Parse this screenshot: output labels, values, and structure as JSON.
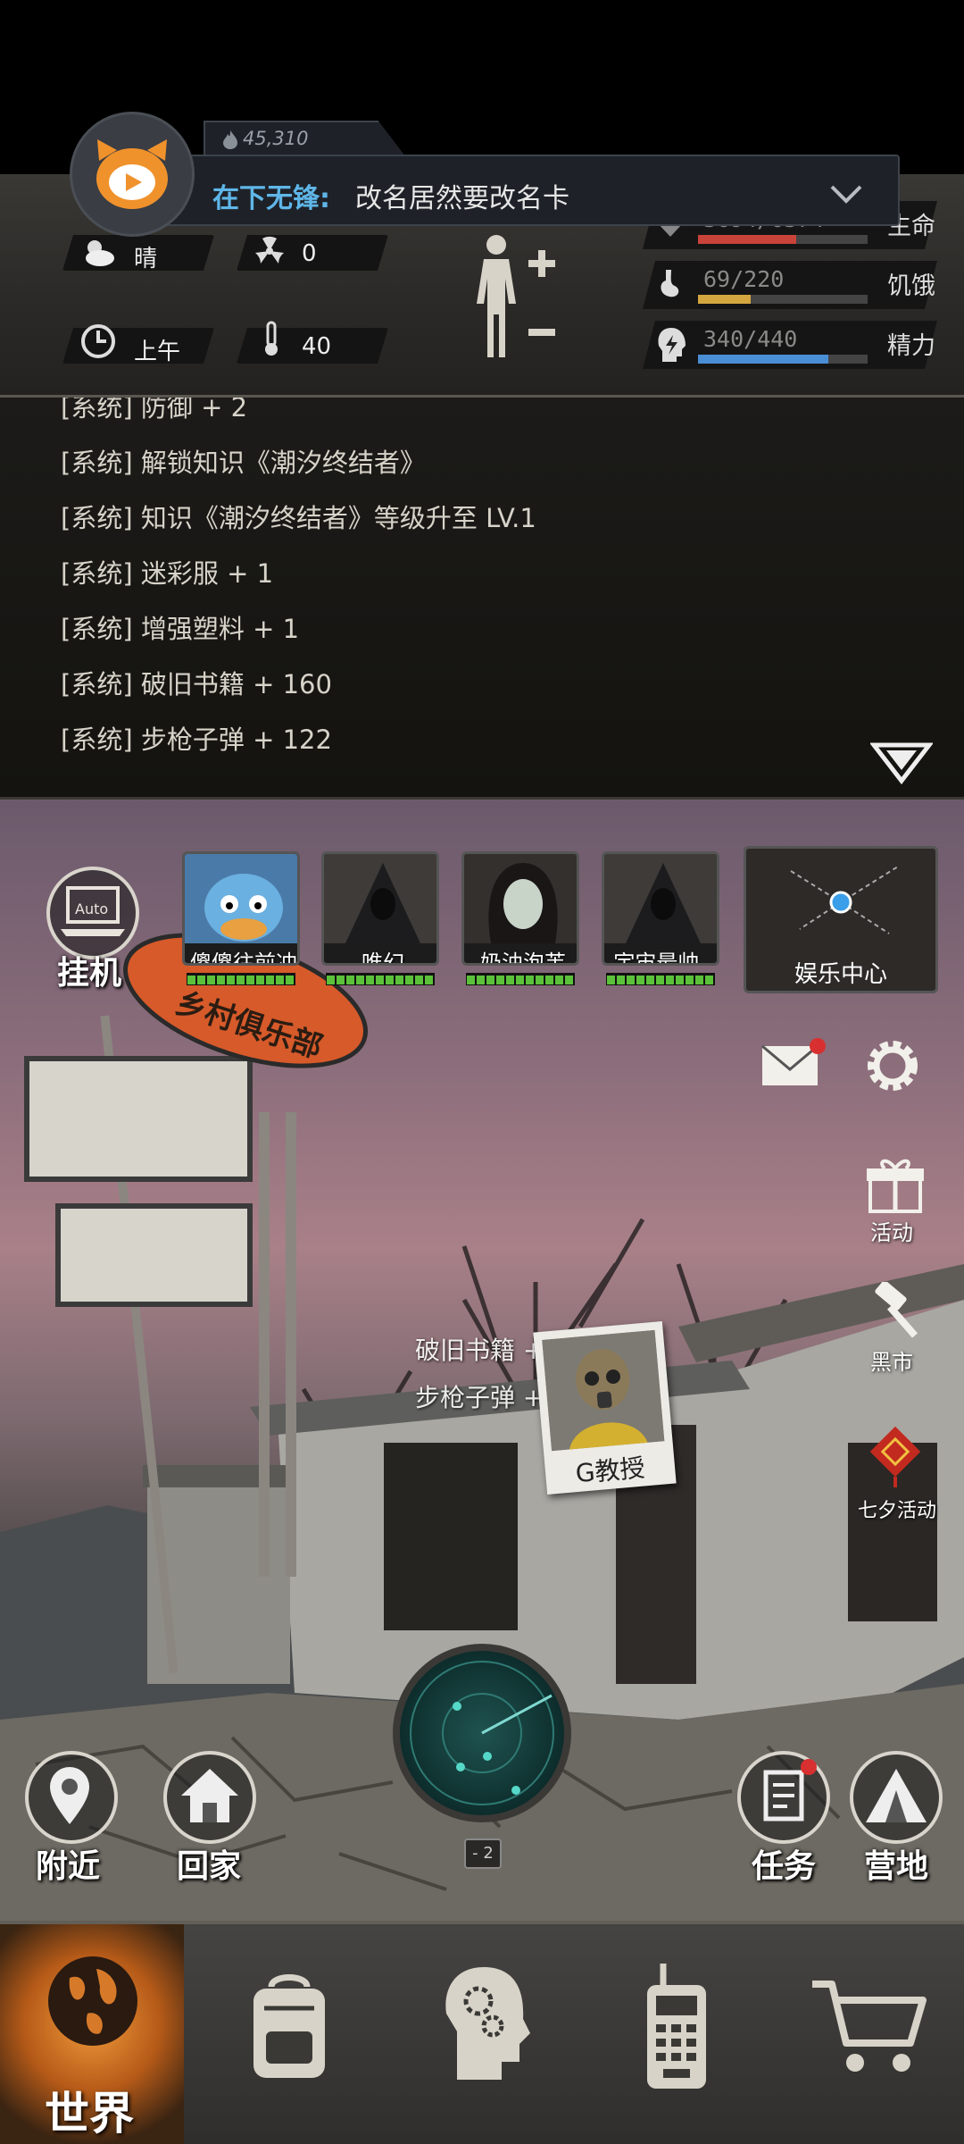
{
  "notification": {
    "count": "45,310",
    "user": "在下无锋:",
    "message": "改名居然要改名卡"
  },
  "status": {
    "weather": "晴",
    "radiation": "0",
    "time_of_day": "上午",
    "temperature": "40",
    "health": {
      "value": "3694/6374",
      "label": "生命",
      "fraction": 0.58,
      "color": "#c8433a"
    },
    "hunger": {
      "value": "69/220",
      "label": "饥饿",
      "fraction": 0.31,
      "color": "#d4a640"
    },
    "energy": {
      "value": "340/440",
      "label": "精力",
      "fraction": 0.77,
      "color": "#4a8fd6"
    }
  },
  "log": [
    "[系统] 防御 + 2",
    "[系统] 解锁知识《潮汐终结者》",
    "[系统] 知识《潮汐终结者》等级升至 LV.1",
    "[系统] 迷彩服 + 1",
    "[系统] 增强塑料 + 1",
    "[系统] 破旧书籍 + 160",
    "[系统] 步枪子弹 + 122"
  ],
  "scene": {
    "auto_label": "挂机",
    "auto_icon_text": "Auto",
    "party": [
      {
        "name": "傻傻往前冲"
      },
      {
        "name": "唯幻"
      },
      {
        "name": "奶油泡芙"
      },
      {
        "name": "宇宙最帅.."
      }
    ],
    "entertainment_label": "娱乐中心",
    "sign_text": "乡村俱乐部",
    "side_buttons": {
      "activity": "活动",
      "black_market": "黑市",
      "qixi": "七夕活动"
    },
    "loot_popup": [
      "破旧书籍 + 160",
      "步枪子弹 + 122"
    ],
    "npc_name": "G教授",
    "radar_level": "- 2",
    "bottom_buttons": {
      "nearby": "附近",
      "home": "回家",
      "tasks": "任务",
      "camp": "营地"
    }
  },
  "nav": {
    "world": "世界",
    "icons": [
      "backpack-icon",
      "skills-head-icon",
      "radio-icon",
      "cart-icon"
    ]
  }
}
